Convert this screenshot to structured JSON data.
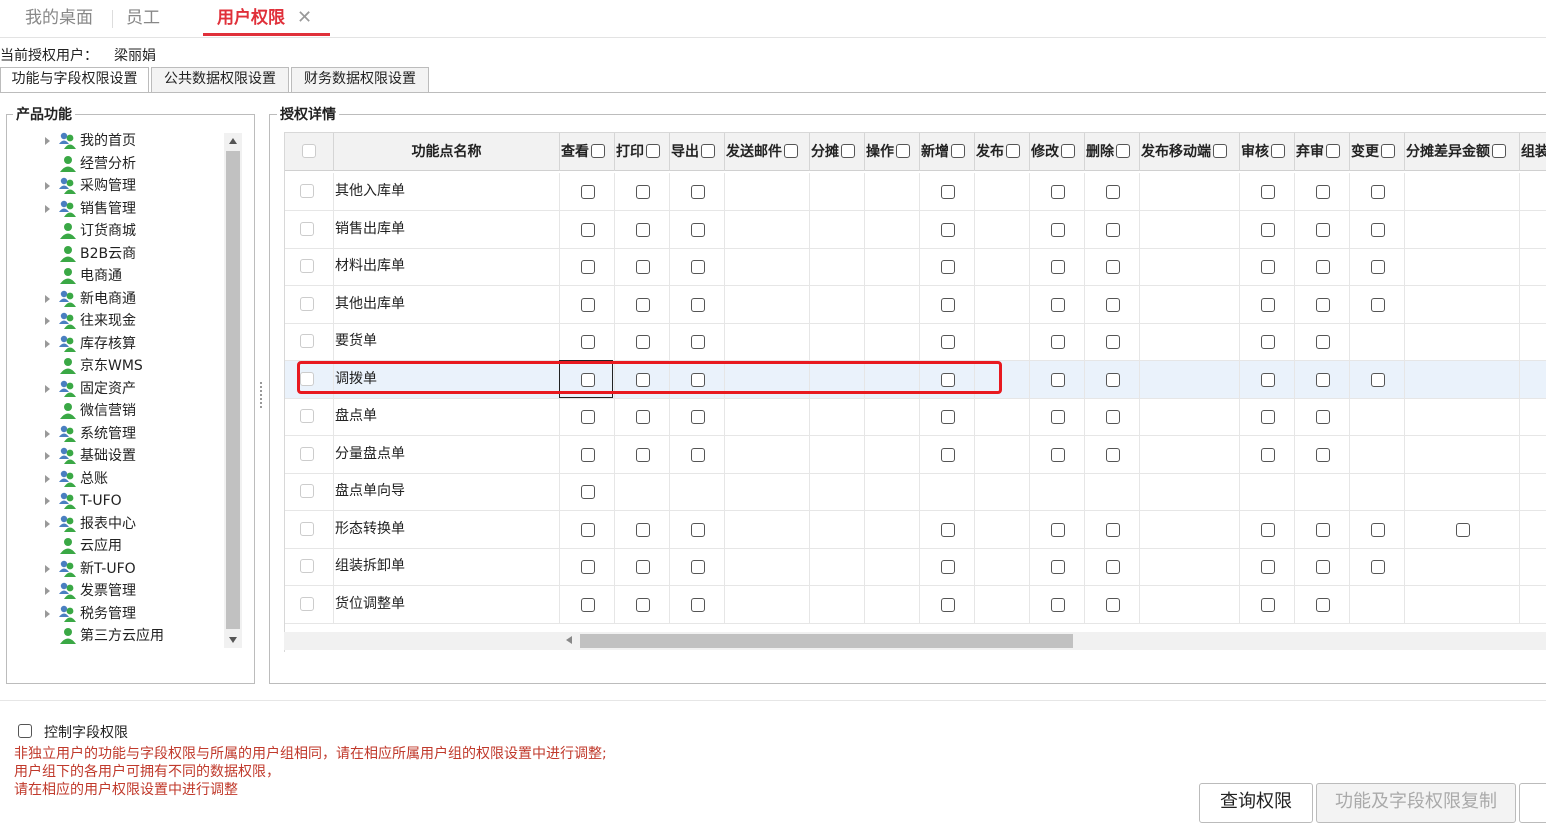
{
  "top_tabs": [
    {
      "label": "我的桌面"
    },
    {
      "label": "员工"
    },
    {
      "label": "用户权限",
      "close": "✕"
    }
  ],
  "current_user": {
    "label": "当前授权用户：",
    "value": "梁丽娟"
  },
  "sub_tabs": [
    "功能与字段权限设置",
    "公共数据权限设置",
    "财务数据权限设置"
  ],
  "product_panel": {
    "title": "产品功能",
    "items": [
      {
        "label": "我的首页",
        "expandable": true,
        "icon": "user-group-icon"
      },
      {
        "label": "经营分析",
        "expandable": false,
        "icon": "user-icon"
      },
      {
        "label": "采购管理",
        "expandable": true,
        "icon": "user-group-icon"
      },
      {
        "label": "销售管理",
        "expandable": true,
        "icon": "user-group-icon"
      },
      {
        "label": "订货商城",
        "expandable": false,
        "icon": "user-icon"
      },
      {
        "label": "B2B云商",
        "expandable": false,
        "icon": "user-icon"
      },
      {
        "label": "电商通",
        "expandable": false,
        "icon": "user-icon"
      },
      {
        "label": "新电商通",
        "expandable": true,
        "icon": "user-group-icon"
      },
      {
        "label": "往来现金",
        "expandable": true,
        "icon": "user-group-icon"
      },
      {
        "label": "库存核算",
        "expandable": true,
        "icon": "user-group-icon"
      },
      {
        "label": "京东WMS",
        "expandable": false,
        "icon": "user-icon"
      },
      {
        "label": "固定资产",
        "expandable": true,
        "icon": "user-group-icon"
      },
      {
        "label": "微信营销",
        "expandable": false,
        "icon": "user-icon"
      },
      {
        "label": "系统管理",
        "expandable": true,
        "icon": "user-group-icon"
      },
      {
        "label": "基础设置",
        "expandable": true,
        "icon": "user-group-icon"
      },
      {
        "label": "总账",
        "expandable": true,
        "icon": "user-group-icon"
      },
      {
        "label": "T-UFO",
        "expandable": true,
        "icon": "user-group-icon"
      },
      {
        "label": "报表中心",
        "expandable": true,
        "icon": "user-group-icon"
      },
      {
        "label": "云应用",
        "expandable": false,
        "icon": "user-icon"
      },
      {
        "label": "新T-UFO",
        "expandable": true,
        "icon": "user-group-icon"
      },
      {
        "label": "发票管理",
        "expandable": true,
        "icon": "user-group-icon"
      },
      {
        "label": "税务管理",
        "expandable": true,
        "icon": "user-group-icon"
      },
      {
        "label": "第三方云应用",
        "expandable": false,
        "icon": "user-icon"
      }
    ]
  },
  "detail_panel": {
    "title": "授权详情",
    "name_header": "功能点名称",
    "columns": [
      "查看",
      "打印",
      "导出",
      "发送邮件",
      "分摊",
      "操作",
      "新增",
      "发布",
      "修改",
      "删除",
      "发布移动端",
      "审核",
      "弃审",
      "变更",
      "分摊差异金额",
      "组装"
    ],
    "rows": [
      {
        "name": "其他入库单",
        "flags": [
          1,
          1,
          1,
          0,
          0,
          0,
          1,
          0,
          1,
          1,
          0,
          1,
          1,
          1,
          0,
          0
        ]
      },
      {
        "name": "销售出库单",
        "flags": [
          1,
          1,
          1,
          0,
          0,
          0,
          1,
          0,
          1,
          1,
          0,
          1,
          1,
          1,
          0,
          0
        ]
      },
      {
        "name": "材料出库单",
        "flags": [
          1,
          1,
          1,
          0,
          0,
          0,
          1,
          0,
          1,
          1,
          0,
          1,
          1,
          1,
          0,
          0
        ]
      },
      {
        "name": "其他出库单",
        "flags": [
          1,
          1,
          1,
          0,
          0,
          0,
          1,
          0,
          1,
          1,
          0,
          1,
          1,
          1,
          0,
          0
        ]
      },
      {
        "name": "要货单",
        "flags": [
          1,
          1,
          1,
          0,
          0,
          0,
          1,
          0,
          1,
          1,
          0,
          1,
          1,
          0,
          0,
          0
        ]
      },
      {
        "name": "调拨单",
        "flags": [
          1,
          1,
          1,
          0,
          0,
          0,
          1,
          0,
          1,
          1,
          0,
          1,
          1,
          1,
          0,
          0
        ],
        "selected": true
      },
      {
        "name": "盘点单",
        "flags": [
          1,
          1,
          1,
          0,
          0,
          0,
          1,
          0,
          1,
          1,
          0,
          1,
          1,
          0,
          0,
          0
        ]
      },
      {
        "name": "分量盘点单",
        "flags": [
          1,
          1,
          1,
          0,
          0,
          0,
          1,
          0,
          1,
          1,
          0,
          1,
          1,
          0,
          0,
          0
        ]
      },
      {
        "name": "盘点单向导",
        "flags": [
          1,
          0,
          0,
          0,
          0,
          0,
          0,
          0,
          0,
          0,
          0,
          0,
          0,
          0,
          0,
          0
        ]
      },
      {
        "name": "形态转换单",
        "flags": [
          1,
          1,
          1,
          0,
          0,
          0,
          1,
          0,
          1,
          1,
          0,
          1,
          1,
          1,
          1,
          0
        ]
      },
      {
        "name": "组装拆卸单",
        "flags": [
          1,
          1,
          1,
          0,
          0,
          0,
          1,
          0,
          1,
          1,
          0,
          1,
          1,
          1,
          0,
          0
        ]
      },
      {
        "name": "货位调整单",
        "flags": [
          1,
          1,
          1,
          0,
          0,
          0,
          1,
          0,
          1,
          1,
          0,
          1,
          1,
          0,
          0,
          0
        ]
      }
    ]
  },
  "control_field": {
    "label": "控制字段权限"
  },
  "notes": [
    "非独立用户的功能与字段权限与所属的用户组相同，请在相应所属用户组的权限设置中进行调整;",
    "用户组下的各用户可拥有不同的数据权限，",
    "请在相应的用户权限设置中进行调整"
  ],
  "buttons": {
    "query": "查询权限",
    "copy": "功能及字段权限复制"
  },
  "colors": {
    "accent": "#e0303a",
    "highlight": "#e8191f",
    "note": "#c0392b",
    "selected_row": "#eaf2fb"
  }
}
